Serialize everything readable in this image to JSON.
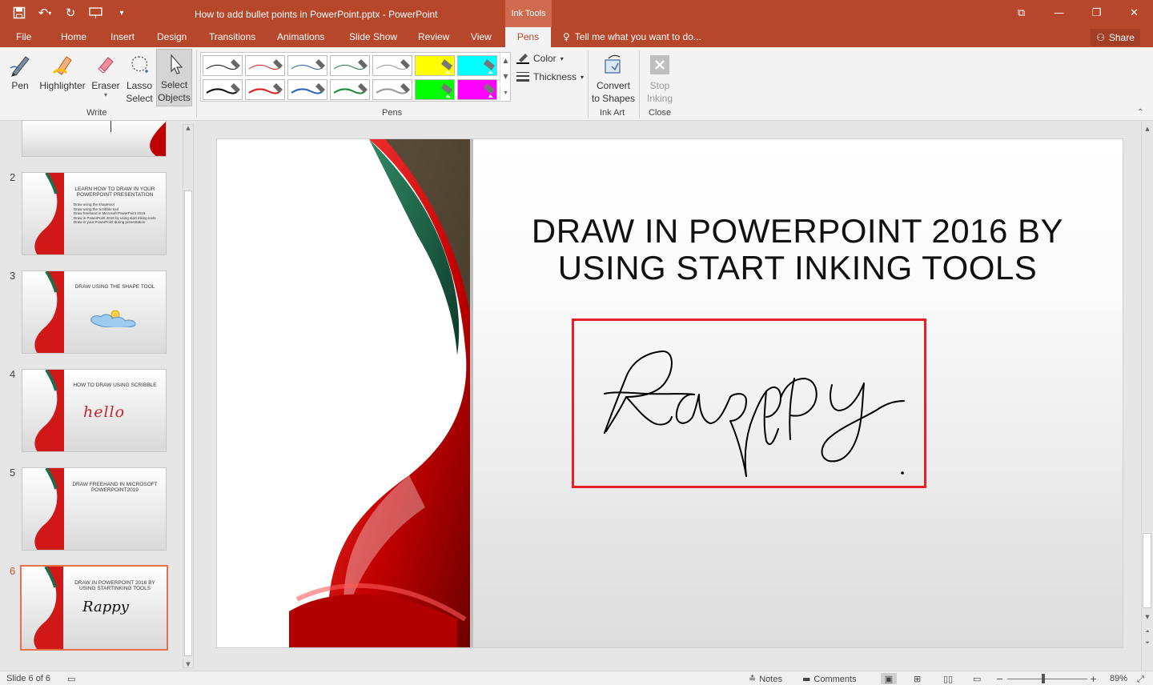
{
  "window": {
    "title": "How to add bullet points in PowerPoint.pptx - PowerPoint",
    "context_tab_group": "Ink Tools",
    "accent_color": "#b7472a"
  },
  "ribbon_tabs": [
    "File",
    "Home",
    "Insert",
    "Design",
    "Transitions",
    "Animations",
    "Slide Show",
    "Review",
    "View"
  ],
  "active_tab": "Pens",
  "tell_me": "Tell me what you want to do...",
  "share": "Share",
  "ribbon": {
    "write": {
      "pen": "Pen",
      "highlighter": "Highlighter",
      "eraser": "Eraser",
      "lasso_1": "Lasso",
      "lasso_2": "Select",
      "select_1": "Select",
      "select_2": "Objects",
      "label": "Write"
    },
    "pens_label": "Pens",
    "color": "Color",
    "thickness": "Thickness",
    "ink_art": {
      "convert_1": "Convert",
      "convert_2": "to Shapes",
      "label": "Ink Art"
    },
    "close": {
      "stop_1": "Stop",
      "stop_2": "Inking",
      "label": "Close"
    }
  },
  "thumbnails": [
    {
      "num": "2",
      "title": "LEARN HOW TO DRAW IN YOUR POWERPOINT PRESENTATION",
      "bullets": [
        "Draw using the shapetool",
        "Draw using the Scribble tool",
        "Draw freehand in Microsoft PowerPoint 2019",
        "Draw in PowerPoint 2016 by using start inking tools",
        "Draw in your PowerPoint during presentation"
      ]
    },
    {
      "num": "3",
      "title": "DRAW USING THE SHAPE TOOL"
    },
    {
      "num": "4",
      "title": "HOW TO DRAW USING SCRIBBLE",
      "ink": "hello"
    },
    {
      "num": "5",
      "title": "DRAW FREEHAND IN MICROSOFT POWERPOINT2019"
    },
    {
      "num": "6",
      "title": "DRAW IN POWERPOINT 2016 BY USING STARTINKING TOOLS",
      "ink": "Rappy"
    }
  ],
  "slide": {
    "title": "DRAW IN POWERPOINT 2016 BY USING START INKING TOOLS",
    "ink_text": "Rappy"
  },
  "status": {
    "slide_pos": "Slide 6 of 6",
    "notes": "Notes",
    "comments": "Comments",
    "zoom": "89%"
  }
}
